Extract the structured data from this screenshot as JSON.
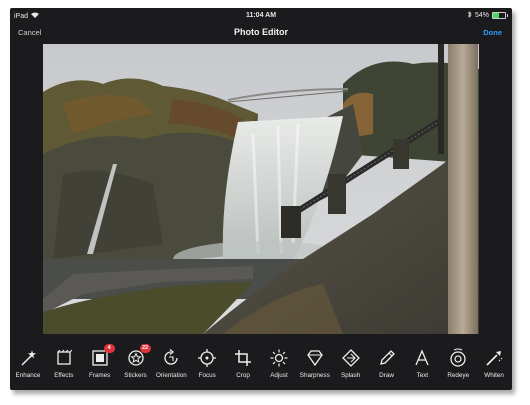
{
  "status": {
    "device": "iPad",
    "time": "11:04 AM",
    "battery": "54%",
    "battery_level": 0.54
  },
  "nav": {
    "cancel": "Cancel",
    "title": "Photo Editor",
    "done": "Done"
  },
  "colors": {
    "accent": "#2f9bff",
    "badge": "#e0323b",
    "background": "#1b1b1e"
  },
  "tools": [
    {
      "label": "Enhance",
      "icon": "magic-wand-icon"
    },
    {
      "label": "Effects",
      "icon": "effects-icon"
    },
    {
      "label": "Frames",
      "icon": "frame-icon",
      "badge": "4"
    },
    {
      "label": "Stickers",
      "icon": "sticker-icon",
      "badge": "22"
    },
    {
      "label": "Orientation",
      "icon": "rotate-icon"
    },
    {
      "label": "Focus",
      "icon": "focus-icon"
    },
    {
      "label": "Crop",
      "icon": "crop-icon"
    },
    {
      "label": "Adjust",
      "icon": "sun-icon"
    },
    {
      "label": "Sharpness",
      "icon": "diamond-icon"
    },
    {
      "label": "Splash",
      "icon": "splash-icon"
    },
    {
      "label": "Draw",
      "icon": "pencil-icon"
    },
    {
      "label": "Text",
      "icon": "text-icon"
    },
    {
      "label": "Redeye",
      "icon": "eye-icon"
    },
    {
      "label": "Whiten",
      "icon": "whiten-icon"
    }
  ]
}
